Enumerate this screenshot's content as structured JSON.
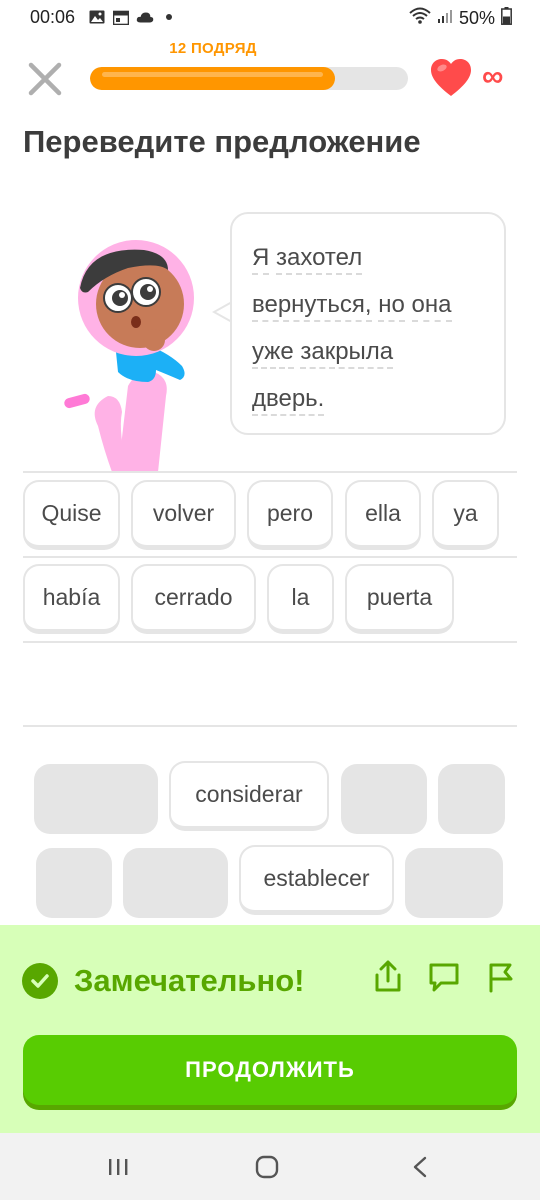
{
  "status_bar": {
    "time": "00:06",
    "battery": "50%",
    "icons": [
      "image-icon",
      "calendar-icon",
      "cloud-icon",
      "dot-icon",
      "wifi-icon",
      "signal-icon",
      "battery-icon"
    ]
  },
  "header": {
    "streak_label": "12 ПОДРЯД",
    "progress_fraction": 0.77,
    "hearts": "∞"
  },
  "page_title": "Переведите предложение",
  "prompt": {
    "lines": [
      [
        "Я",
        "захотел"
      ],
      [
        "вернуться,",
        "но",
        "она"
      ],
      [
        "уже",
        "закрыла"
      ],
      [
        "дверь."
      ]
    ]
  },
  "answer": {
    "row1": [
      "Quise",
      "volver",
      "pero",
      "ella",
      "ya"
    ],
    "row2": [
      "había",
      "cerrado",
      "la",
      "puerta"
    ]
  },
  "word_bank": {
    "row1_word": "considerar",
    "row2_word": "establecer"
  },
  "feedback": {
    "title": "Замечательно!",
    "continue_label": "ПРОДОЛЖИТЬ"
  },
  "colors": {
    "accent_green": "#58cc02",
    "feedback_green_text": "#58a700",
    "feedback_bg": "#d7ffb8",
    "streak_orange": "#ff9600",
    "heart_red": "#ff4b4b"
  }
}
